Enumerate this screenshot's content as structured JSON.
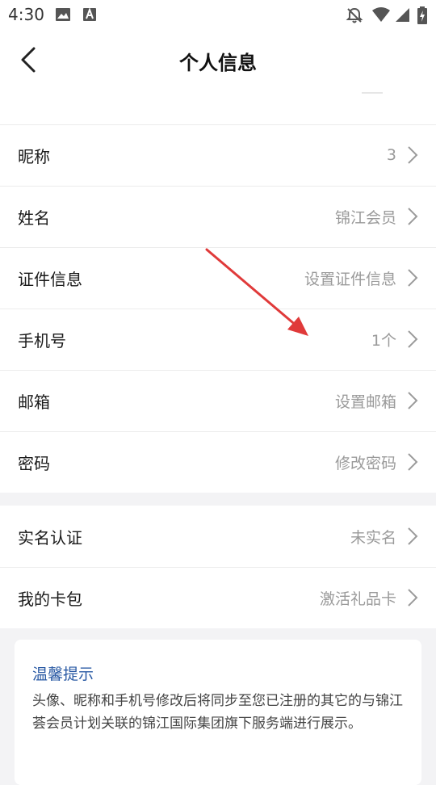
{
  "status_bar": {
    "time": "4:30",
    "left_icons": [
      "image-icon",
      "text-a-icon"
    ],
    "right_icons": [
      "bell-off-icon",
      "wifi-icon",
      "signal-icon",
      "battery-charging-icon"
    ]
  },
  "header": {
    "title": "个人信息",
    "back_icon": "chevron-left-icon"
  },
  "profile_group": [
    {
      "label": "昵称",
      "value": "3"
    },
    {
      "label": "姓名",
      "value": "锦江会员"
    },
    {
      "label": "证件信息",
      "value": "设置证件信息"
    },
    {
      "label": "手机号",
      "value": "1个"
    },
    {
      "label": "邮箱",
      "value": "设置邮箱"
    },
    {
      "label": "密码",
      "value": "修改密码"
    }
  ],
  "account_group": [
    {
      "label": "实名认证",
      "value": "未实名"
    },
    {
      "label": "我的卡包",
      "value": "激活礼品卡"
    }
  ],
  "tip": {
    "title": "温馨提示",
    "body": "头像、昵称和手机号修改后将同步至您已注册的其它的与锦江荟会员计划关联的锦江国际集团旗下服务端进行展示。"
  },
  "colors": {
    "tip_title": "#2a5aa4",
    "annotation_arrow": "#e03a3a",
    "value_text": "#9a9a9a",
    "page_bg": "#f3f3f5"
  }
}
